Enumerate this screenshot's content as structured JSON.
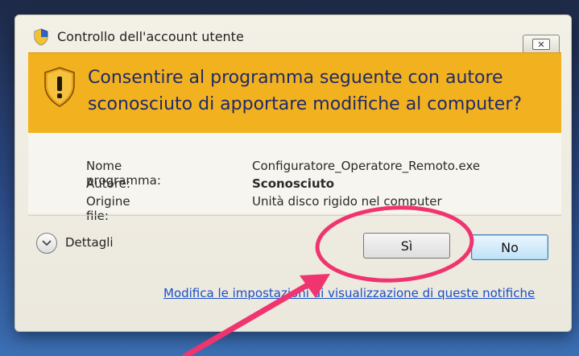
{
  "window": {
    "title": "Controllo dell'account utente",
    "close_label": "✕"
  },
  "banner": {
    "line1": "Consentire al programma seguente con autore",
    "line2": "sconosciuto di apportare modifiche al computer?"
  },
  "details": {
    "rows": [
      {
        "label": "Nome programma:",
        "value": "Configuratore_Operatore_Remoto.exe",
        "bold": false
      },
      {
        "label": "Autore:",
        "value": "Sconosciuto",
        "bold": true
      },
      {
        "label": "Origine file:",
        "value": "Unità disco rigido nel computer",
        "bold": false
      }
    ]
  },
  "footer": {
    "details_label": "Dettagli",
    "yes_label": "Sì",
    "no_label": "No",
    "settings_link": "Modifica le impostazioni di visualizzazione di queste notifiche"
  },
  "colors": {
    "banner": "#f2b11e",
    "banner_text": "#1f2a6a",
    "link": "#1a4ec8",
    "annotation": "#f0346f"
  },
  "icons": {
    "title": "uac-shield-icon",
    "banner": "warning-shield-icon",
    "details_toggle": "chevron-down-icon"
  }
}
